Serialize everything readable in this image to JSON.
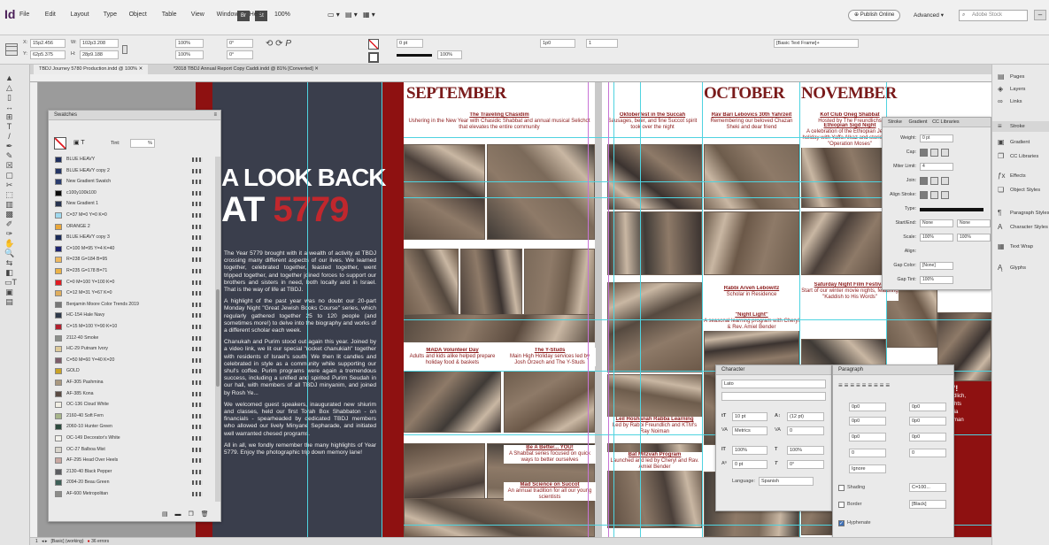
{
  "app": {
    "logo": "Id"
  },
  "menu": [
    "File",
    "Edit",
    "Layout",
    "Type",
    "Object",
    "Table",
    "View",
    "Window",
    "Help"
  ],
  "zoom": "100%",
  "publish_online": "Publish Online",
  "workspace": "Advanced",
  "search_placeholder": "Adobe Stock",
  "control": {
    "x": "15p2.456",
    "y": "62p5.375",
    "w": "102p3.208",
    "h": "28p9.188",
    "scale_x": "100%",
    "scale_y": "100%",
    "angle": "0°",
    "shear": "0°",
    "stroke_weight": "1 pt",
    "opacity": "100%",
    "gutter": "1p0",
    "columns": "1",
    "style_field": "[Basic Text Frame]+",
    "pt0": "0 pt"
  },
  "tabs": [
    "TBDJ Journey 5780 Production.indd @ 100%",
    "*2018 TBDJ Annual Report Copy Caddi.indd @ 81% [Converted]"
  ],
  "swatches": {
    "title": "Swatches",
    "tint_label": "Tint:",
    "tint_value": "%",
    "items": [
      {
        "name": "BLUE HEAVY",
        "color": "#1f2f5e"
      },
      {
        "name": "BLUE HEAVY copy 2",
        "color": "#243565"
      },
      {
        "name": "New Gradient Swatch",
        "color": "#2a3c6e"
      },
      {
        "name": "c100y100k100",
        "color": "#0c0c0c"
      },
      {
        "name": "New Gradient 1",
        "color": "#27334f"
      },
      {
        "name": "C=37 M=0 Y=0 K=0",
        "color": "#9fd8ee"
      },
      {
        "name": "ORANGE 2",
        "color": "#e8a63a"
      },
      {
        "name": "BLUE HEAVY copy 3",
        "color": "#1b2b58"
      },
      {
        "name": "C=100 M=95 Y=4 K=40",
        "color": "#1d2470"
      },
      {
        "name": "R=238 G=184 B=95",
        "color": "#eeb85f"
      },
      {
        "name": "R=235 G=178 B=71",
        "color": "#ebb247"
      },
      {
        "name": "C=0 M=100 Y=100 K=0",
        "color": "#e11b22"
      },
      {
        "name": "C=12 M=31 Y=67 K=0",
        "color": "#dfae5e"
      },
      {
        "name": "Benjamin Moore Color Trends 2019",
        "color": "#777777"
      },
      {
        "name": "HC-154 Hale Navy",
        "color": "#2f3a4a"
      },
      {
        "name": "C=15 M=100 Y=90 K=10",
        "color": "#b21f2d"
      },
      {
        "name": "2112-40 Smoke",
        "color": "#8c8f8a"
      },
      {
        "name": "HC-29 Putnam Ivory",
        "color": "#ddc999"
      },
      {
        "name": "C=50 M=60 Y=40 K=20",
        "color": "#7d5d6a"
      },
      {
        "name": "GOLD",
        "color": "#c9a227"
      },
      {
        "name": "AF-305 Pashmina",
        "color": "#a9987f"
      },
      {
        "name": "AF-385 Kona",
        "color": "#5a4b43"
      },
      {
        "name": "OC-136 Cloud White",
        "color": "#f1eee4"
      },
      {
        "name": "2160-40 Soft Fern",
        "color": "#a7b58a"
      },
      {
        "name": "2060-10 Hunter Green",
        "color": "#2c4a3d"
      },
      {
        "name": "OC-149 Decorator's White",
        "color": "#f3f2ec"
      },
      {
        "name": "OC-27 Balboa Mist",
        "color": "#d8d4cb"
      },
      {
        "name": "AF-295 Head Over Heels",
        "color": "#c8a7a0"
      },
      {
        "name": "2130-40 Black Pepper",
        "color": "#5b5c60"
      },
      {
        "name": "2094-20 Beau Green",
        "color": "#3d5f57"
      },
      {
        "name": "AF-600 Metropolitan",
        "color": "#8c8c89"
      }
    ]
  },
  "spread": {
    "headline_1": "A LOOK BACK",
    "headline_2a": "AT ",
    "headline_2b": "5779",
    "para1": "The Year 5779 brought with it a wealth of activity at TBDJ crossing many different aspects of our lives. We learned together, celebrated together, feasted together, went tripped together, and together joined forces to support our brothers and sisters in need, both locally and in Israel. That is the way of life at TBDJ.",
    "para2": "A highlight of the past year was no doubt our 20-part Monday Night \"Great Jewish Books Course\" series, which regularly gathered together 25 to 120 people (and sometimes more!) to delve into the biography and works of a different scholar each week.",
    "para3": "Chanukah and Purim stood out again this year. Joined by a video link, we lit our special \"rocket chanukiah\" together with residents of Israel's south. We then lit candles and celebrated in style as a community while supporting our shul's coffee. Purim programs were again a tremendous success, including a unified and spirited Purim Seudah in our hall, with members of all TBDJ minyanim, and joined by Rosh Ye...",
    "para4": "We welcomed guest speakers, inaugurated new shiurim and classes, held our first Torah Box Shabbaton - on financials - spearheaded by dedicated TBDJ members who allowed our lively Minyane Sepharade, and initiated well warranted chesed programs.",
    "para5": "All in all, we fondly remember the many highlights of Year 5779. Enjoy the photographic trip down memory lane!",
    "month_sep": "SEPTEMBER",
    "month_oct": "OCTOBER",
    "month_nov": "NOVEMBER",
    "captions": {
      "c1_title": "The Traveling Chasidim",
      "c1_body": "Ushering in the New Year with Chasidic Shabbat and annual musical Selichot that elevates the entire community",
      "c2_title": "Oktoberfest in the Succah",
      "c2_body": "Sausages, beer, and fine Succot spirit took over the night",
      "c3_title": "Rav Bari Lebovics 30th Yahrzeit",
      "c3_body": "Remembering our beloved Chazan Sheki and dear friend",
      "c4_title": "Kof Club Oneg Shabbat",
      "c4_body": "Hosted by The Freundlichs",
      "c5_title": "Ethiopian Sigd Night",
      "c5_body": "A celebration of the Ethiopian Jewish holiday with Yaffa Alkaz and stories from \"Operation Moses\"",
      "c6_title": "Rabbi Arveh Lebowitz",
      "c6_body": "Scholar in Residence",
      "c7_title": "Saturday Night Film Festival",
      "c7_body": "Start of our winter movie nights, featuring \"Kaddish to His Words\"",
      "c8_title": "\"Night Light\"",
      "c8_body": "A seasonal learning program with Cheryl & Rev. Amiel Bender",
      "c9_title": "MADA Volunteer Day",
      "c9_body": "Adults and kids alike helped prepare holiday food & baskets",
      "c10_title": "The Y-Studs",
      "c10_body": "Main High Holiday services led by Josh Orzech and The Y-Studs",
      "c11_title": "Be A Better... YOU!",
      "c11_body": "A Shabbat series focused on quick ways to better ourselves",
      "c12_title": "Mad Science on Succot",
      "c12_body": "An annual tradition for all our young scientists",
      "c13_title": "Leil Hoshanah Rabba Learning",
      "c13_body": "Led by Rabbi Freundlich and KTM's Ray Noiman",
      "c14_title": "Bat Mitzvah Program",
      "c14_body": "Launched and led by Cheryl and Rav. Amiel Bender"
    },
    "right_frag": [
      "ss\"!",
      "reundlich,",
      "n nights",
      "Felicia",
      "Whitman"
    ]
  },
  "stroke_panel": {
    "tabs": [
      "Stroke",
      "Gradient",
      "CC Libraries"
    ],
    "weight_label": "Weight:",
    "weight": "0 pt",
    "cap_label": "Cap:",
    "miter_label": "Miter Limit:",
    "miter": "4",
    "x_label": "x",
    "join_label": "Join:",
    "align_label": "Align Stroke:",
    "type_label": "Type:",
    "start_label": "Start/End:",
    "start": "None",
    "end": "None",
    "scale_label": "Scale:",
    "scale1": "100%",
    "scale2": "100%",
    "align2_label": "Align:",
    "gap_label": "Gap Color:",
    "gap_color": "[None]",
    "gap_tint_label": "Gap Tint:",
    "gap_tint": "100%"
  },
  "char_panel": {
    "title": "Character",
    "font": "Lato",
    "style": "",
    "size": "10 pt",
    "leading": "(12 pt)",
    "kerning": "Metrics",
    "tracking": "0",
    "vscale": "100%",
    "hscale": "100%",
    "baseline": "0 pt",
    "skew": "0°",
    "language_label": "Language:",
    "language": "Spanish"
  },
  "para_panel": {
    "title": "Paragraph",
    "v1": "0p0",
    "v2": "0p0",
    "v3": "0p0",
    "v4": "0p0",
    "v5": "0p0",
    "v6": "0p0",
    "drop": "0",
    "drop2": "0",
    "ignore": "Ignore",
    "shading_label": "Shading",
    "shading_val": "C=100...",
    "border_label": "Border",
    "border_val": "[Black]",
    "hyphenate_label": "Hyphenate"
  },
  "dock": {
    "items": [
      {
        "label": "Pages",
        "icon": "pages-icon",
        "glyph": "▤"
      },
      {
        "label": "Layers",
        "icon": "layers-icon",
        "glyph": "◈"
      },
      {
        "label": "Links",
        "icon": "links-icon",
        "glyph": "∞"
      },
      {
        "label": "Stroke",
        "icon": "stroke-icon",
        "glyph": "≡"
      },
      {
        "label": "Gradient",
        "icon": "gradient-icon",
        "glyph": "▣"
      },
      {
        "label": "CC Libraries",
        "icon": "cc-libraries-icon",
        "glyph": "❐"
      },
      {
        "label": "Effects",
        "icon": "effects-icon",
        "glyph": "ƒx"
      },
      {
        "label": "Object Styles",
        "icon": "object-styles-icon",
        "glyph": "❏"
      },
      {
        "label": "Paragraph Styles",
        "icon": "paragraph-styles-icon",
        "glyph": "¶"
      },
      {
        "label": "Character Styles",
        "icon": "character-styles-icon",
        "glyph": "A"
      },
      {
        "label": "Text Wrap",
        "icon": "text-wrap-icon",
        "glyph": "▦"
      },
      {
        "label": "Glyphs",
        "icon": "glyphs-icon",
        "glyph": "Ą"
      }
    ]
  },
  "status": {
    "page": "1",
    "style": "[Basic] (working)",
    "errors": "36 errors"
  }
}
